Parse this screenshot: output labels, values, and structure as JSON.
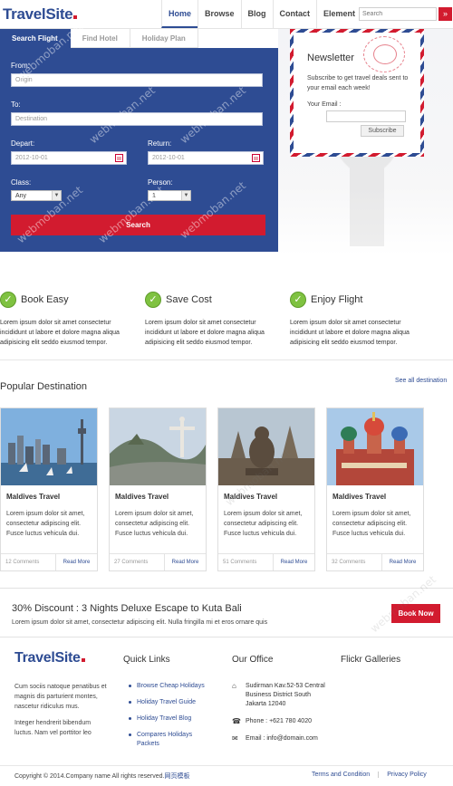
{
  "header": {
    "logo_part1": "Travel",
    "logo_part2": "Site",
    "nav": [
      "Home",
      "Browse",
      "Blog",
      "Contact",
      "Element"
    ],
    "search_placeholder": "Search"
  },
  "booking": {
    "tabs": [
      "Search Flight",
      "Find Hotel",
      "Holiday Plan"
    ],
    "from_label": "From:",
    "from_placeholder": "Origin",
    "to_label": "To:",
    "to_placeholder": "Destination",
    "depart_label": "Depart:",
    "depart_value": "2012-10-01",
    "return_label": "Return:",
    "return_value": "2012-10-01",
    "class_label": "Class:",
    "class_value": "Any",
    "person_label": "Person:",
    "person_value": "1",
    "search_label": "Search"
  },
  "newsletter": {
    "title": "Newsletter",
    "text": "Subscribe to get travel deals sent to your email each week!",
    "email_label": "Your Email :",
    "button": "Subscribe"
  },
  "features": [
    {
      "title": "Book Easy",
      "text": "Lorem ipsum dolor sit amet consectetur incididunt ut labore et dolore magna aliqua adipisicing elit seddo eiusmod tempor."
    },
    {
      "title": "Save Cost",
      "text": "Lorem ipsum dolor sit amet consectetur incididunt ut labore et dolore magna aliqua adipisicing elit seddo eiusmod tempor."
    },
    {
      "title": "Enjoy Flight",
      "text": "Lorem ipsum dolor sit amet consectetur incididunt ut labore et dolore magna aliqua adipisicing elit seddo eiusmod tempor."
    }
  ],
  "popular": {
    "title": "Popular Destination",
    "see_all": "See all destination",
    "cards": [
      {
        "title": "Maldives Travel",
        "text": "Lorem ipsum dolor sit amet, consectetur adipiscing elit. Fusce luctus vehicula dui.",
        "comments": "12 Comments",
        "more": "Read More"
      },
      {
        "title": "Maldives Travel",
        "text": "Lorem ipsum dolor sit amet, consectetur adipiscing elit. Fusce luctus vehicula dui.",
        "comments": "27 Comments",
        "more": "Read More"
      },
      {
        "title": "Maldives Travel",
        "text": "Lorem ipsum dolor sit amet, consectetur adipiscing elit. Fusce luctus vehicula dui.",
        "comments": "51 Comments",
        "more": "Read More"
      },
      {
        "title": "Maldives Travel",
        "text": "Lorem ipsum dolor sit amet, consectetur adipiscing elit. Fusce luctus vehicula dui.",
        "comments": "32 Comments",
        "more": "Read More"
      }
    ]
  },
  "discount": {
    "title": "30% Discount : 3 Nights Deluxe Escape to Kuta Bali",
    "text": "Lorem ipsum dolor sit amet, consectetur adipiscing elit. Nulla fringilla mi et eros ornare quis",
    "button": "Book Now"
  },
  "footer": {
    "logo_part1": "Travel",
    "logo_part2": "Site",
    "about1": "Cum sociis natoque penatibus et magnis dis parturient montes, nascetur ridiculus mus.",
    "about2": "Integer hendrerit bibendum luctus. Nam vel porttitor leo",
    "quick_links_title": "Quick Links",
    "quick_links": [
      "Browse Cheap Holidays",
      "Holiday Travel Guide",
      "Holiday Travel Blog",
      "Compares Holidays Packets"
    ],
    "office_title": "Our Office",
    "address": "Sudirman Kav.52-53 Central Business District South Jakarta 12040",
    "phone": "Phone : +621 780 4020",
    "email": "Email : info@domain.com",
    "flickr_title": "Flickr Galleries",
    "copyright": "Copyright © 2014.Company name All rights reserved.",
    "copyright_link": "网页模板",
    "terms": "Terms and Condition",
    "privacy": "Privacy Policy"
  },
  "watermark": "webmoban.net",
  "colors": {
    "brand_blue": "#2e4c93",
    "accent_red": "#d21b2f",
    "check_green": "#7fc241"
  }
}
